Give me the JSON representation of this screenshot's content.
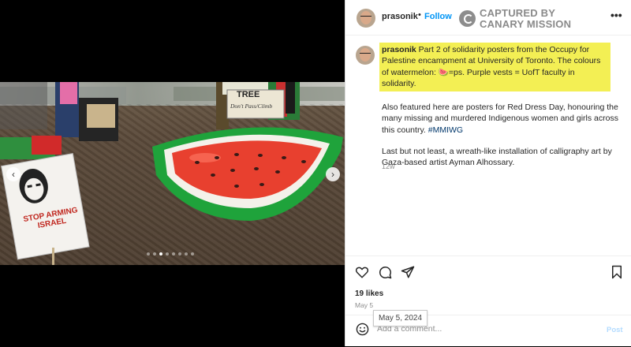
{
  "post": {
    "username": "prasonik",
    "bullet": "•",
    "follow_label": "Follow",
    "more_label": "•••"
  },
  "watermark": {
    "line1": "CAPTURED BY",
    "line2": "CANARY MISSION"
  },
  "caption": {
    "username": "prasonik",
    "highlight_text": " Part 2 of solidarity posters from the Occupy for Palestine encampment at University of Toronto. The colours of watermelon: 🍉=ps. Purple vests = UofT faculty in solidarity.",
    "para2_text": "Also featured here are posters for Red Dress Day, honouring the many missing and murdered Indigenous women and girls across this country. ",
    "para2_tag": "#MMIWG",
    "para3_text": "Last but not least, a wreath-like installation of calligraphy art by Gaza-based artist Ayman Alhossary.",
    "age": "12w"
  },
  "photo": {
    "sign_left_text": "STOP ARMING ISRAEL",
    "sign_tree_line1": "TREE",
    "sign_tree_line2": "Don't Pass/Climb",
    "carousel": {
      "prev": "‹",
      "next": "›",
      "count": 8,
      "active_index": 2
    }
  },
  "actions": {
    "likes": "19 likes",
    "date": "May 5",
    "tooltip": "May 5, 2024",
    "comment_placeholder": "Add a comment...",
    "post_label": "Post"
  },
  "icons": [
    "heart-icon",
    "comment-icon",
    "share-icon",
    "bookmark-icon",
    "emoji-icon",
    "chevron-left-icon",
    "chevron-right-icon",
    "more-icon"
  ],
  "colors": {
    "follow": "#0095f6",
    "highlight": "#f3ef54",
    "watermelon_red": "#e8402f",
    "watermelon_green": "#1fa33b"
  }
}
